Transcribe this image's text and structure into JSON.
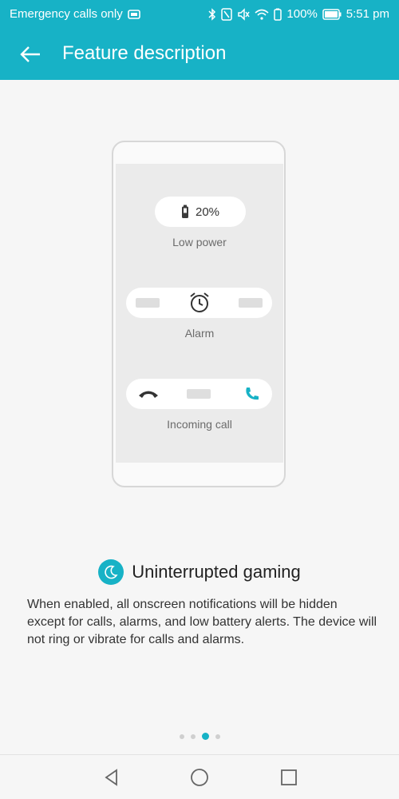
{
  "status_bar": {
    "carrier_text": "Emergency calls only",
    "battery_percent": "100%",
    "time": "5:51 pm",
    "icons": [
      "sim-icon",
      "bluetooth-icon",
      "nfc-icon",
      "mute-icon",
      "wifi-icon",
      "battery-saver-icon",
      "battery-icon"
    ]
  },
  "header": {
    "title": "Feature description",
    "back_icon": "back-arrow-icon"
  },
  "illustration": {
    "battery_level": "20%",
    "low_power_label": "Low power",
    "alarm_label": "Alarm",
    "incoming_call_label": "Incoming call"
  },
  "feature": {
    "icon": "moon-icon",
    "title": "Uninterrupted gaming",
    "description": "When enabled, all onscreen notifications will be hidden except for calls, alarms, and low battery alerts. The device will not ring or vibrate for calls and alarms."
  },
  "pager": {
    "count": 4,
    "active_index": 2
  },
  "nav_bar": {
    "icons": [
      "back-triangle-icon",
      "home-circle-icon",
      "recents-square-icon"
    ]
  },
  "colors": {
    "accent": "#17b2c6"
  }
}
